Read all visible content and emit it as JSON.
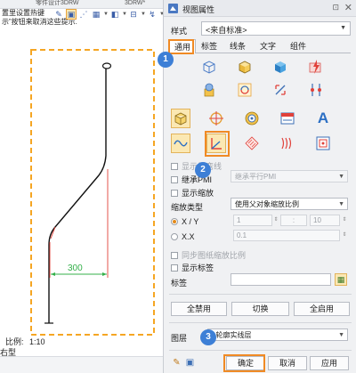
{
  "canvas": {
    "top_tab_text_1": "零件设计3DRW",
    "top_tab_text_2": "3DRW*",
    "top_tab_text_3": "工作",
    "hint_line_1": "置里设置热键",
    "hint_line_2": "示”按钮来取消这些提示.",
    "dimension_value": "300",
    "scale_label": "比例:",
    "scale_value": "1:10",
    "model_tab": "右型",
    "accent_frame_color": "#f5a623",
    "dimension_color": "#34b04a",
    "leader_color": "#e0413a"
  },
  "panel": {
    "title": "视图属性",
    "style_label": "样式",
    "style_value": "<来自标准>",
    "tabs": [
      {
        "label": "通用",
        "active": true
      },
      {
        "label": "标签",
        "active": false
      },
      {
        "label": "线条",
        "active": false
      },
      {
        "label": "文字",
        "active": false
      },
      {
        "label": "组件",
        "active": false
      }
    ],
    "grid_icons": [
      "box-outline-icon",
      "box-shaded-icon",
      "box-solid-icon",
      "flash-part-icon",
      "gear-part-icon",
      "rotate-swap-icon",
      "flip-arrow-icon",
      "align-points-icon",
      "box-wire-icon",
      "target-center-icon",
      "circle-gear-icon",
      "rectangle-label-icon",
      "text-a-icon",
      "wave-curve-icon",
      "axis-origin-icon",
      "hatch-pattern-icon",
      "parallel-lines-icon",
      "grid-dots-icon"
    ],
    "show_fold_label": "显示折弯线",
    "pmi_label": "继承PMI",
    "pmi_value": "继承平行PMI",
    "show_scale_label": "显示缩放",
    "scale_type_label": "缩放类型",
    "scale_type_value": "使用父对象缩放比例",
    "xy_label": "X / Y",
    "xx_label": "X.X",
    "ratio_left": "1",
    "ratio_sep": ":",
    "ratio_right": "10",
    "decimal_value": "0.1",
    "sync_label": "同步图纸缩放比例",
    "show_tag_label": "显示标签",
    "tag_label": "标签",
    "disable_all": "全禁用",
    "toggle": "切换",
    "enable_all": "全启用",
    "layer_label": "图层",
    "layer_value": "1轮廓实线层",
    "ok": "确定",
    "cancel": "取消",
    "apply": "应用",
    "badge_1": "1",
    "badge_2": "2",
    "badge_3": "3",
    "badge_color": "#3d7fd6",
    "highlight_color": "#f08a24"
  }
}
